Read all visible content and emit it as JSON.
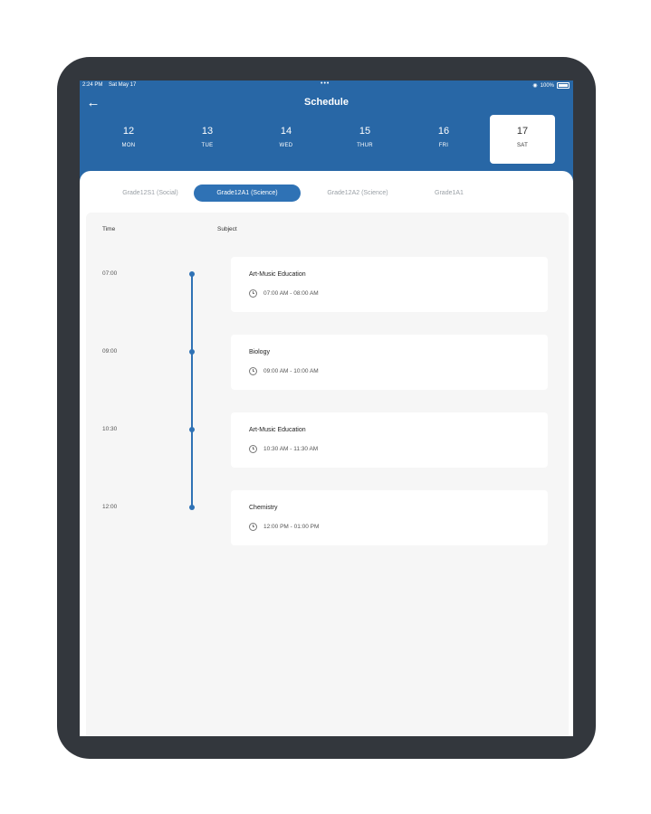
{
  "status_bar": {
    "time": "2:24 PM",
    "date": "Sat May 17",
    "battery": "100%"
  },
  "header": {
    "title": "Schedule",
    "back_icon": "arrow-left-icon"
  },
  "days": [
    {
      "num": "12",
      "name": "MON"
    },
    {
      "num": "13",
      "name": "TUE"
    },
    {
      "num": "14",
      "name": "WED"
    },
    {
      "num": "15",
      "name": "THUR"
    },
    {
      "num": "16",
      "name": "FRI"
    },
    {
      "num": "17",
      "name": "SAT",
      "selected": true
    }
  ],
  "tabs": [
    {
      "label": "Grade12S1 (Social)"
    },
    {
      "label": "Grade12A1 (Science)",
      "active": true
    },
    {
      "label": "Grade12A2 (Science)"
    },
    {
      "label": "Grade1A1"
    }
  ],
  "table": {
    "time_header": "Time",
    "subject_header": "Subject",
    "entries": [
      {
        "time": "07:00",
        "subject": "Art-Music Education",
        "range": "07:00 AM - 08:00 AM"
      },
      {
        "time": "09:00",
        "subject": "Biology",
        "range": "09:00 AM - 10:00 AM"
      },
      {
        "time": "10:30",
        "subject": "Art-Music Education",
        "range": "10:30 AM - 11:30 AM"
      },
      {
        "time": "12:00",
        "subject": "Chemistry",
        "range": "12:00 PM - 01:00 PM"
      }
    ]
  },
  "colors": {
    "primary": "#2867a6",
    "accent": "#2f72b5",
    "device_frame": "#33373d"
  }
}
